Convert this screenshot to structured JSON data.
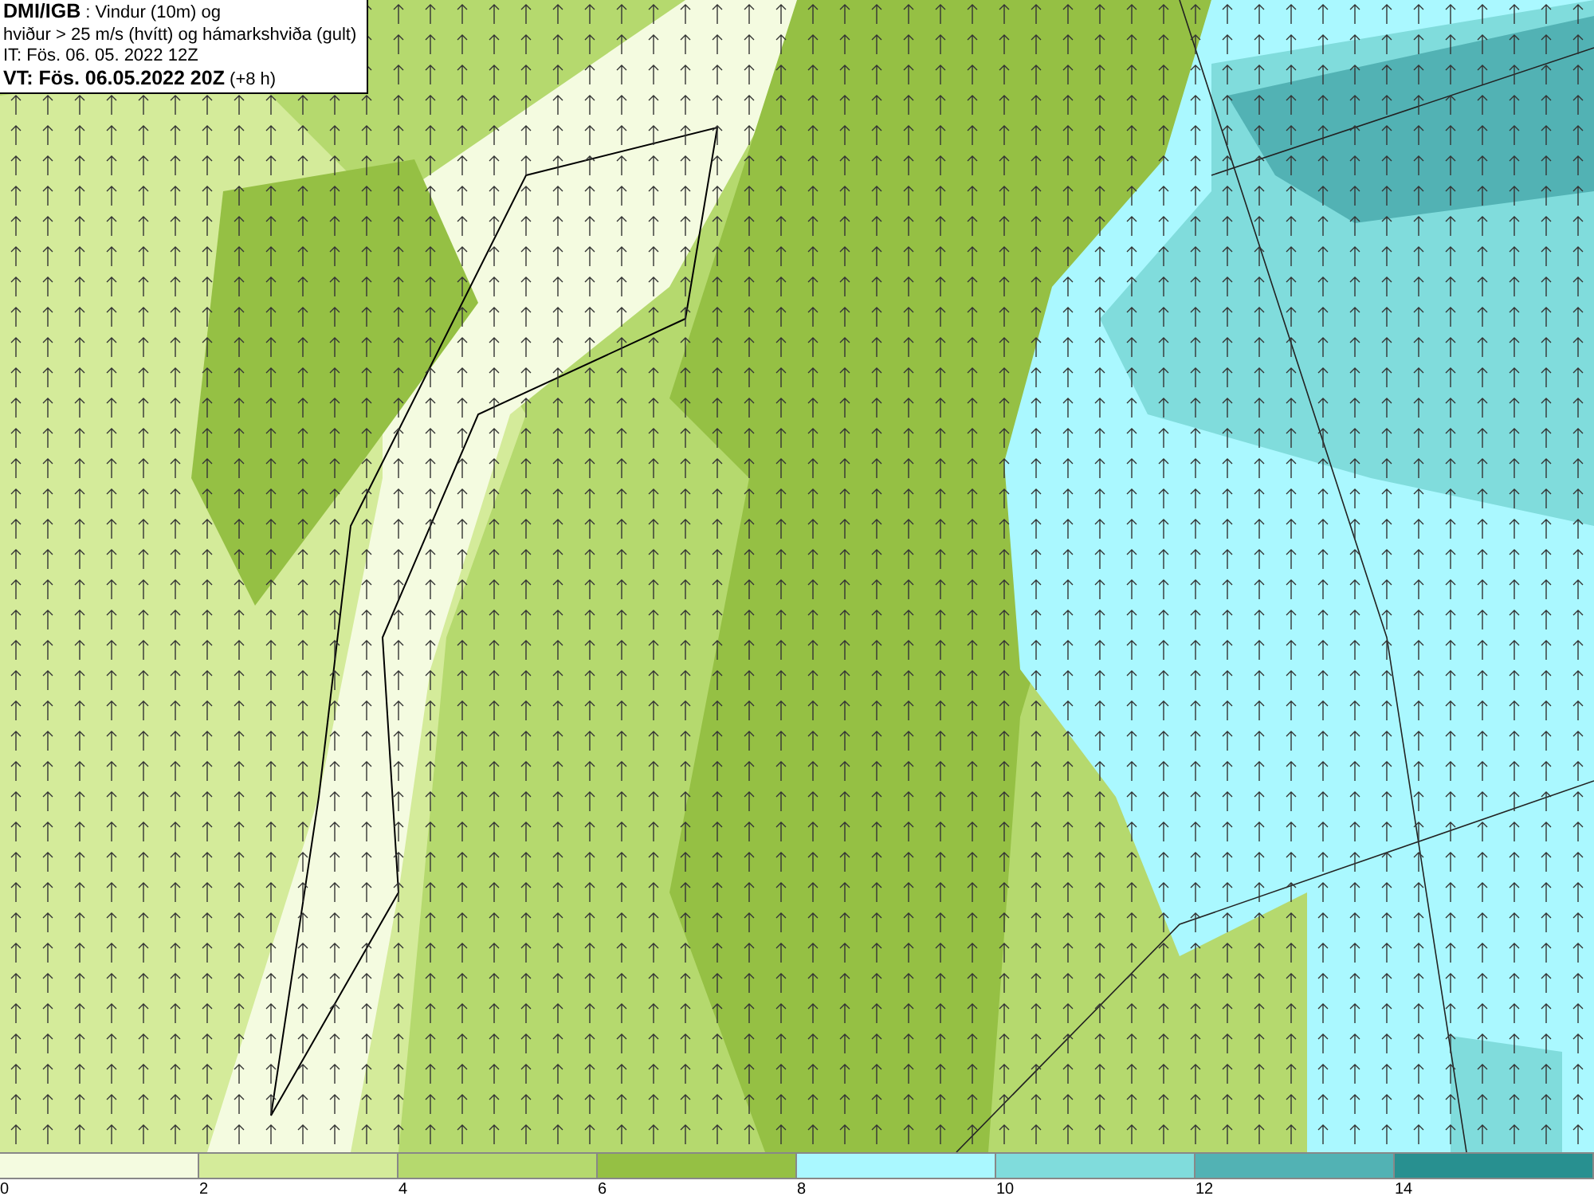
{
  "header": {
    "lines": [
      "**DMI/IGB** : Vindur (10m) og",
      "hviður > 25 m/s (hvítt) og hámarkshviða (gult)",
      "IT: Fös. 06. 05. 2022 12Z",
      "**VT: Fös. 06.05.2022 20Z** (+8 h)"
    ]
  },
  "legend": {
    "bins": [
      {
        "color": "#f4fbe0"
      },
      {
        "color": "#d4eb9a"
      },
      {
        "color": "#b5d96e"
      },
      {
        "color": "#95c044"
      },
      {
        "color": "#aaf8ff"
      },
      {
        "color": "#80dcdc"
      },
      {
        "color": "#52b2b4"
      },
      {
        "color": "#289090"
      }
    ],
    "ticks": [
      "0",
      "2",
      "4",
      "6",
      "8",
      "10",
      "12",
      "14"
    ]
  }
}
